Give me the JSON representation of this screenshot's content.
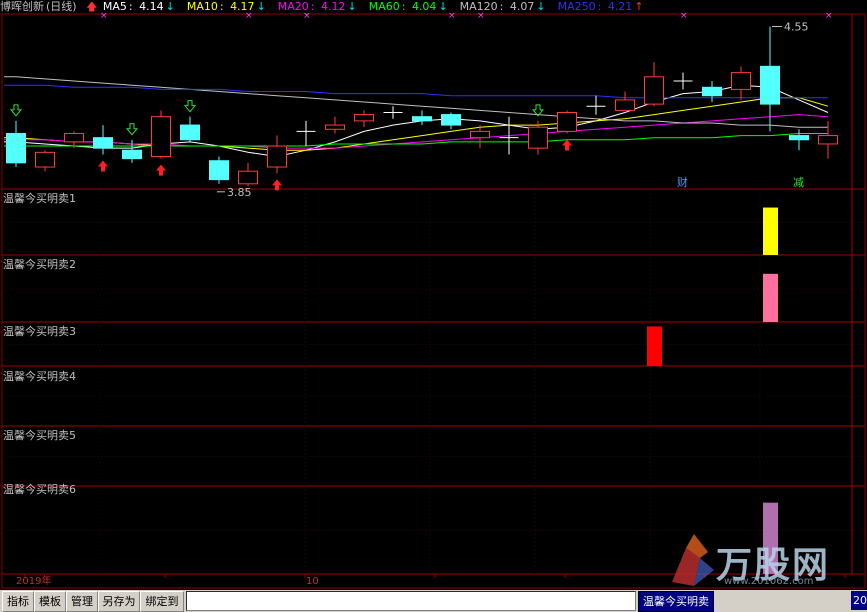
{
  "header": {
    "stock_name": "博晖创新",
    "period": "(日线)",
    "ma": [
      {
        "label": "MA5",
        "value": "4.14",
        "dir": "down",
        "color": "#ffffff"
      },
      {
        "label": "MA10",
        "value": "4.17",
        "dir": "down",
        "color": "#ffff00"
      },
      {
        "label": "MA20",
        "value": "4.12",
        "dir": "down",
        "color": "#ff00ff"
      },
      {
        "label": "MA60",
        "value": "4.04",
        "dir": "down",
        "color": "#00ff00"
      },
      {
        "label": "MA120",
        "value": "4.07",
        "dir": "down",
        "color": "#c0c0c0"
      },
      {
        "label": "MA250",
        "value": "4.21",
        "dir": "up",
        "color": "#3030ff"
      }
    ]
  },
  "annotations": {
    "high_label": "4.55",
    "low_label": "3.85",
    "event_cai": "财",
    "event_jian": "减"
  },
  "panels": [
    {
      "label": "温馨今买明卖1"
    },
    {
      "label": "温馨今买明卖2"
    },
    {
      "label": "温馨今买明卖3"
    },
    {
      "label": "温馨今买明卖4"
    },
    {
      "label": "温馨今买明卖5"
    },
    {
      "label": "温馨今买明卖6"
    }
  ],
  "xaxis": {
    "year_label": "2019年",
    "month_label": "10"
  },
  "toolbar": {
    "btn_indicator": "指标",
    "btn_template": "模板",
    "btn_manage": "管理",
    "btn_saveas": "另存为",
    "btn_bind": "绑定到",
    "active_tab": "温馨今买明卖",
    "page_num": "20"
  },
  "watermark": {
    "text": "万股网",
    "url": "www.201062.com"
  },
  "chart_data": {
    "type": "candlestick",
    "candles": [
      {
        "o": 4.04,
        "c": 3.9,
        "h": 4.1,
        "l": 3.88
      },
      {
        "o": 3.88,
        "c": 3.95,
        "h": 3.96,
        "l": 3.86
      },
      {
        "o": 4.0,
        "c": 4.04,
        "h": 4.05,
        "l": 3.97
      },
      {
        "o": 4.02,
        "c": 3.97,
        "h": 4.08,
        "l": 3.94
      },
      {
        "o": 3.96,
        "c": 3.92,
        "h": 4.01,
        "l": 3.9
      },
      {
        "o": 3.93,
        "c": 4.12,
        "h": 4.15,
        "l": 3.92
      },
      {
        "o": 4.08,
        "c": 4.01,
        "h": 4.12,
        "l": 4.0
      },
      {
        "o": 3.91,
        "c": 3.82,
        "h": 3.93,
        "l": 3.8
      },
      {
        "o": 3.8,
        "c": 3.86,
        "h": 3.9,
        "l": 3.79
      },
      {
        "o": 3.88,
        "c": 3.98,
        "h": 4.03,
        "l": 3.85
      },
      {
        "o": 4.05,
        "c": 4.05,
        "h": 4.1,
        "l": 3.98
      },
      {
        "o": 4.06,
        "c": 4.08,
        "h": 4.12,
        "l": 4.04
      },
      {
        "o": 4.1,
        "c": 4.13,
        "h": 4.15,
        "l": 4.07
      },
      {
        "o": 4.14,
        "c": 4.14,
        "h": 4.17,
        "l": 4.11
      },
      {
        "o": 4.12,
        "c": 4.1,
        "h": 4.15,
        "l": 4.08
      },
      {
        "o": 4.13,
        "c": 4.08,
        "h": 4.14,
        "l": 4.06
      },
      {
        "o": 4.02,
        "c": 4.05,
        "h": 4.08,
        "l": 3.97
      },
      {
        "o": 4.02,
        "c": 4.02,
        "h": 4.12,
        "l": 3.94
      },
      {
        "o": 3.97,
        "c": 4.07,
        "h": 4.1,
        "l": 3.94
      },
      {
        "o": 4.05,
        "c": 4.14,
        "h": 4.15,
        "l": 4.04
      },
      {
        "o": 4.17,
        "c": 4.17,
        "h": 4.22,
        "l": 4.13
      },
      {
        "o": 4.15,
        "c": 4.2,
        "h": 4.24,
        "l": 4.15
      },
      {
        "o": 4.18,
        "c": 4.31,
        "h": 4.38,
        "l": 4.17
      },
      {
        "o": 4.29,
        "c": 4.29,
        "h": 4.33,
        "l": 4.25
      },
      {
        "o": 4.26,
        "c": 4.22,
        "h": 4.29,
        "l": 4.19
      },
      {
        "o": 4.25,
        "c": 4.33,
        "h": 4.36,
        "l": 4.2
      },
      {
        "o": 4.36,
        "c": 4.18,
        "h": 4.55,
        "l": 4.05
      },
      {
        "o": 4.03,
        "c": 4.01,
        "h": 4.06,
        "l": 3.96
      },
      {
        "o": 3.99,
        "c": 4.03,
        "h": 4.1,
        "l": 3.92
      }
    ],
    "ma_lines": [
      {
        "name": "MA5",
        "color": "#ffffff",
        "values": [
          4.0,
          3.99,
          3.98,
          3.97,
          3.97,
          3.99,
          4.0,
          3.98,
          3.95,
          3.93,
          3.96,
          4.0,
          4.05,
          4.08,
          4.1,
          4.11,
          4.1,
          4.08,
          4.06,
          4.07,
          4.1,
          4.14,
          4.19,
          4.23,
          4.24,
          4.27,
          4.26,
          4.2,
          4.14
        ]
      },
      {
        "name": "MA10",
        "color": "#ffff00",
        "values": [
          4.02,
          4.01,
          4.0,
          4.0,
          3.99,
          3.98,
          3.98,
          3.98,
          3.97,
          3.96,
          3.96,
          3.97,
          3.99,
          4.01,
          4.03,
          4.05,
          4.07,
          4.08,
          4.08,
          4.09,
          4.1,
          4.11,
          4.13,
          4.15,
          4.17,
          4.19,
          4.21,
          4.21,
          4.17
        ]
      },
      {
        "name": "MA20",
        "color": "#ff00ff",
        "values": [
          4.01,
          4.01,
          4.0,
          4.0,
          3.99,
          3.99,
          3.98,
          3.98,
          3.98,
          3.97,
          3.97,
          3.97,
          3.98,
          3.99,
          4.0,
          4.01,
          4.02,
          4.03,
          4.04,
          4.05,
          4.06,
          4.07,
          4.08,
          4.09,
          4.1,
          4.11,
          4.12,
          4.13,
          4.12
        ]
      },
      {
        "name": "MA60",
        "color": "#00ff00",
        "values": [
          3.98,
          3.98,
          3.98,
          3.98,
          3.98,
          3.98,
          3.98,
          3.98,
          3.98,
          3.98,
          3.98,
          3.99,
          3.99,
          3.99,
          3.99,
          4.0,
          4.0,
          4.0,
          4.0,
          4.01,
          4.01,
          4.01,
          4.02,
          4.02,
          4.02,
          4.03,
          4.03,
          4.04,
          4.04
        ]
      },
      {
        "name": "MA120",
        "color": "#c0c0c0",
        "values": [
          4.31,
          4.3,
          4.29,
          4.28,
          4.27,
          4.26,
          4.25,
          4.24,
          4.23,
          4.22,
          4.21,
          4.2,
          4.19,
          4.18,
          4.17,
          4.16,
          4.15,
          4.14,
          4.13,
          4.12,
          4.11,
          4.1,
          4.1,
          4.09,
          4.09,
          4.08,
          4.08,
          4.07,
          4.07
        ]
      },
      {
        "name": "MA250",
        "color": "#3030ff",
        "values": [
          4.27,
          4.27,
          4.26,
          4.26,
          4.26,
          4.25,
          4.25,
          4.25,
          4.24,
          4.24,
          4.24,
          4.23,
          4.23,
          4.23,
          4.23,
          4.22,
          4.22,
          4.22,
          4.22,
          4.22,
          4.22,
          4.21,
          4.21,
          4.21,
          4.21,
          4.21,
          4.21,
          4.21,
          4.21
        ]
      }
    ],
    "ylim": [
      3.78,
      4.6
    ],
    "buy_arrows": [
      3,
      5,
      9,
      19
    ],
    "hollow_down_arrows": [
      0,
      4,
      6,
      18
    ],
    "bars_panels": [
      {
        "panel": 1,
        "index": 26,
        "color": "#ffff00",
        "value": 1
      },
      {
        "panel": 2,
        "index": 26,
        "color": "#ff6fa0",
        "value": 1
      },
      {
        "panel": 3,
        "index": 22,
        "color": "#ff0000",
        "value": 1
      },
      {
        "panel": 6,
        "index": 26,
        "color": "#b070b0",
        "value": 1
      }
    ],
    "bar_tops": {
      "1": 0.73,
      "2": 0.73,
      "3": 0.92,
      "6": 0.82
    }
  }
}
